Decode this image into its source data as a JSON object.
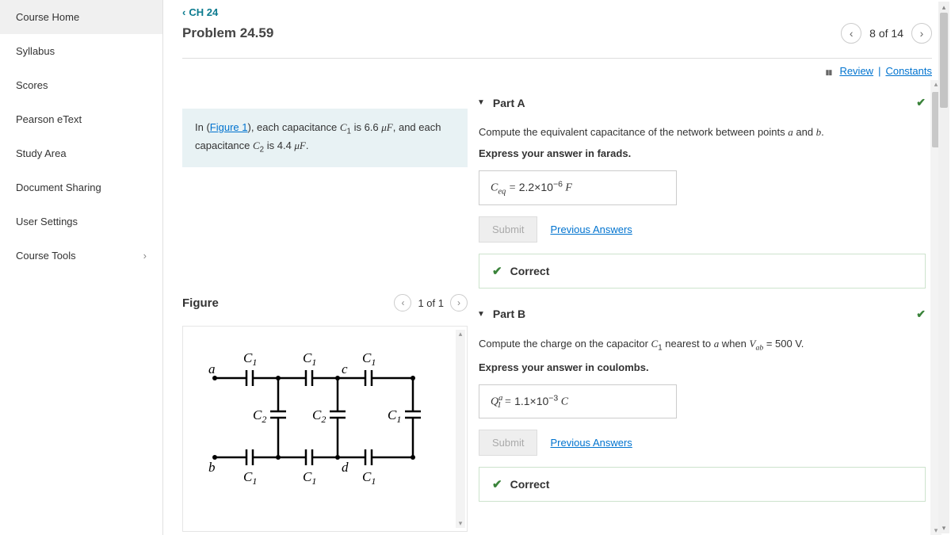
{
  "sidebar": {
    "items": [
      {
        "label": "Course Home",
        "active": true
      },
      {
        "label": "Syllabus"
      },
      {
        "label": "Scores"
      },
      {
        "label": "Pearson eText"
      },
      {
        "label": "Study Area"
      },
      {
        "label": "Document Sharing"
      },
      {
        "label": "User Settings"
      },
      {
        "label": "Course Tools",
        "expandable": true
      }
    ]
  },
  "breadcrumb": {
    "label": "CH 24"
  },
  "problem": {
    "title": "Problem 24.59"
  },
  "pager": {
    "text": "8 of 14"
  },
  "toolbar": {
    "review": "Review",
    "constants": "Constants"
  },
  "prompt": {
    "pre": "In (",
    "link": "Figure 1",
    "post1": "), each capacitance ",
    "c1": "C",
    "c1sub": "1",
    "c1val": " is 6.6 ",
    "mu1": "μF",
    "mid": ", and each capacitance ",
    "c2": "C",
    "c2sub": "2",
    "c2val": " is 4.4 ",
    "mu2": "μF",
    "end": "."
  },
  "figure": {
    "title": "Figure",
    "pager": "1 of 1"
  },
  "partA": {
    "title": "Part A",
    "q1": "Compute the equivalent capacitance of the network between points ",
    "qa": "a",
    "qand": " and ",
    "qb": "b",
    "qend": ".",
    "instruct": "Express your answer in farads.",
    "lhs": "C",
    "lhssub": "eq",
    "eq": " = ",
    "val": "2.2×10",
    "exp": "−6",
    "unit": "  F",
    "submit": "Submit",
    "prev": "Previous Answers",
    "correct": "Correct"
  },
  "partB": {
    "title": "Part B",
    "q1": "Compute the charge on the capacitor ",
    "qc": "C",
    "qcsub": "1",
    "q2": " nearest to ",
    "qa": "a",
    "q3": " when ",
    "qv": "V",
    "qvsub": "ab",
    "q4": " = 500 V.",
    "instruct": "Express your answer in coulombs.",
    "lhs": "Q",
    "lhssup": "a",
    "lhssub": "1",
    "eq": " = ",
    "val": "1.1×10",
    "exp": "−3",
    "unit": "  C",
    "submit": "Submit",
    "prev": "Previous Answers",
    "correct": "Correct"
  },
  "circuit": {
    "labels": {
      "a": "a",
      "b": "b",
      "c": "c",
      "d": "d",
      "C1": "C",
      "C1sub": "1",
      "C2": "C",
      "C2sub": "2"
    }
  }
}
